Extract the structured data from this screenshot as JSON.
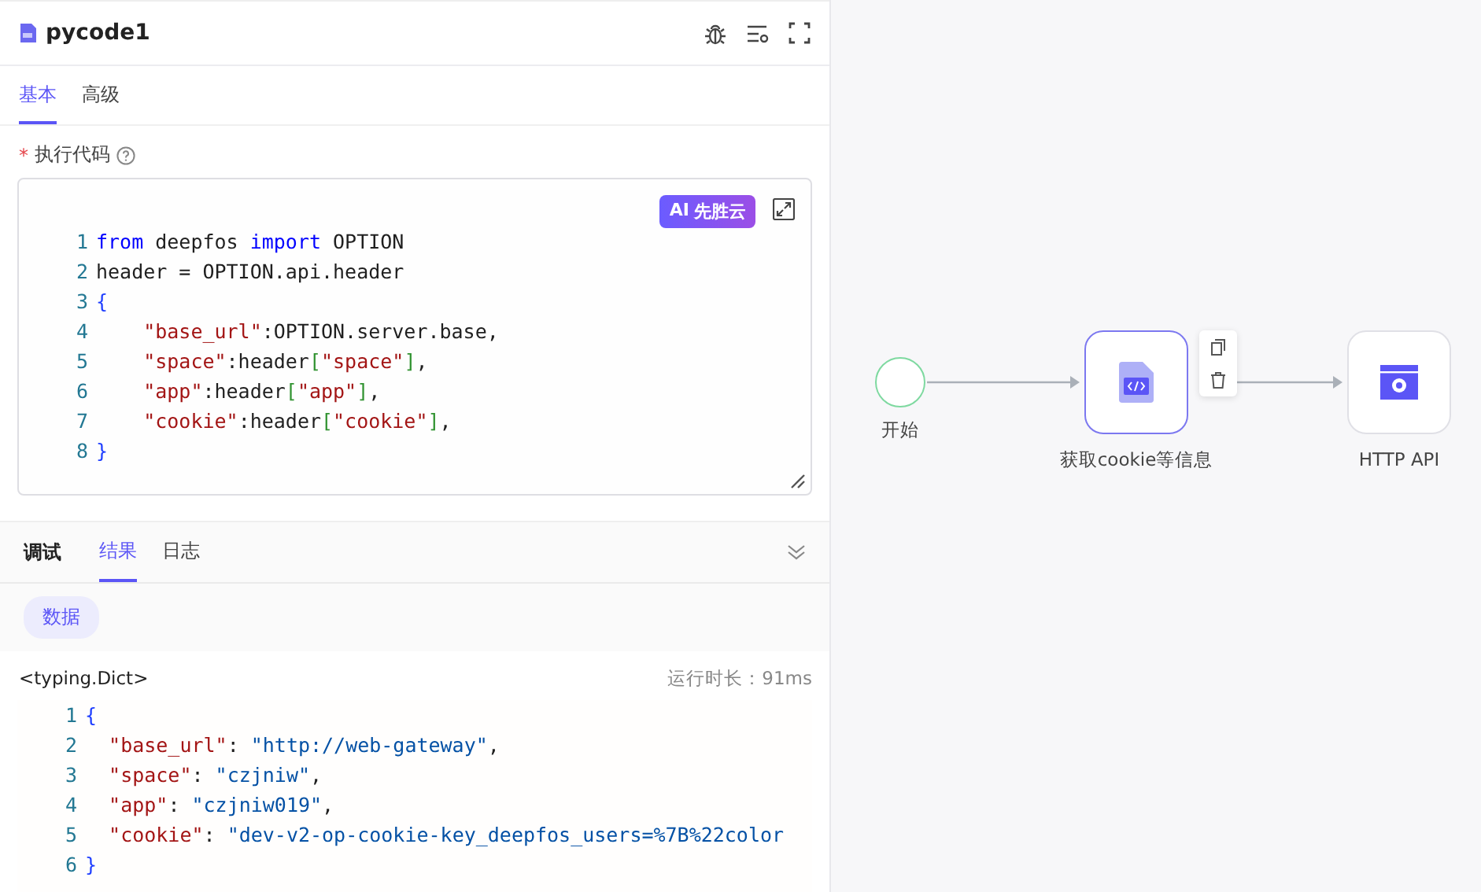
{
  "panel": {
    "title": "pycode1",
    "tabs": [
      {
        "label": "基本",
        "selected": true
      },
      {
        "label": "高级",
        "selected": false
      }
    ],
    "field": {
      "required_mark": "*",
      "label": "执行代码"
    },
    "ai_button": {
      "label": "AI",
      "brand": "先胜云"
    },
    "code_lines": [
      {
        "number": "1",
        "tokens": [
          {
            "kind": "kw",
            "text": "from"
          },
          {
            "kind": "plain",
            "text": " deepfos "
          },
          {
            "kind": "kw",
            "text": "import"
          },
          {
            "kind": "plain",
            "text": " OPTION"
          }
        ]
      },
      {
        "number": "2",
        "tokens": [
          {
            "kind": "plain",
            "text": "header = OPTION.api.header"
          }
        ]
      },
      {
        "number": "3",
        "tokens": [
          {
            "kind": "brace",
            "text": "{"
          }
        ]
      },
      {
        "number": "4",
        "indented": true,
        "tokens": [
          {
            "kind": "str",
            "text": "\"base_url\""
          },
          {
            "kind": "plain",
            "text": ":OPTION.server.base,"
          }
        ]
      },
      {
        "number": "5",
        "indented": true,
        "tokens": [
          {
            "kind": "str",
            "text": "\"space\""
          },
          {
            "kind": "plain",
            "text": ":header"
          },
          {
            "kind": "bracket",
            "text": "["
          },
          {
            "kind": "str",
            "text": "\"space\""
          },
          {
            "kind": "bracket",
            "text": "]"
          },
          {
            "kind": "plain",
            "text": ","
          }
        ]
      },
      {
        "number": "6",
        "indented": true,
        "tokens": [
          {
            "kind": "str",
            "text": "\"app\""
          },
          {
            "kind": "plain",
            "text": ":header"
          },
          {
            "kind": "bracket",
            "text": "["
          },
          {
            "kind": "str",
            "text": "\"app\""
          },
          {
            "kind": "bracket",
            "text": "]"
          },
          {
            "kind": "plain",
            "text": ","
          }
        ]
      },
      {
        "number": "7",
        "indented": true,
        "tokens": [
          {
            "kind": "str",
            "text": "\"cookie\""
          },
          {
            "kind": "plain",
            "text": ":header"
          },
          {
            "kind": "bracket",
            "text": "["
          },
          {
            "kind": "str",
            "text": "\"cookie\""
          },
          {
            "kind": "bracket",
            "text": "]"
          },
          {
            "kind": "plain",
            "text": ","
          }
        ]
      },
      {
        "number": "8",
        "tokens": [
          {
            "kind": "brace",
            "text": "}"
          }
        ]
      }
    ]
  },
  "debug": {
    "title": "调试",
    "tabs": [
      {
        "label": "结果",
        "selected": true
      },
      {
        "label": "日志",
        "selected": false
      }
    ],
    "chip": "数据",
    "type": "<typing.Dict>",
    "runtime": "运行时长：91ms",
    "result_lines": [
      {
        "number": "1",
        "tokens": [
          {
            "kind": "brace",
            "text": "{"
          }
        ]
      },
      {
        "number": "2",
        "indented": true,
        "tokens": [
          {
            "kind": "key",
            "text": "\"base_url\""
          },
          {
            "kind": "plain",
            "text": ": "
          },
          {
            "kind": "value",
            "text": "\"http://web-gateway\""
          },
          {
            "kind": "plain",
            "text": ","
          }
        ]
      },
      {
        "number": "3",
        "indented": true,
        "tokens": [
          {
            "kind": "key",
            "text": "\"space\""
          },
          {
            "kind": "plain",
            "text": ": "
          },
          {
            "kind": "value",
            "text": "\"czjniw\""
          },
          {
            "kind": "plain",
            "text": ","
          }
        ]
      },
      {
        "number": "4",
        "indented": true,
        "tokens": [
          {
            "kind": "key",
            "text": "\"app\""
          },
          {
            "kind": "plain",
            "text": ": "
          },
          {
            "kind": "value",
            "text": "\"czjniw019\""
          },
          {
            "kind": "plain",
            "text": ","
          }
        ]
      },
      {
        "number": "5",
        "indented": true,
        "tokens": [
          {
            "kind": "key",
            "text": "\"cookie\""
          },
          {
            "kind": "plain",
            "text": ": "
          },
          {
            "kind": "value",
            "text": "\"dev-v2-op-cookie-key_deepfos_users=%7B%22color"
          }
        ]
      },
      {
        "number": "6",
        "tokens": [
          {
            "kind": "brace",
            "text": "}"
          }
        ]
      }
    ]
  },
  "flow": {
    "nodes": [
      {
        "kind": "start",
        "label": "开始",
        "selected": false
      },
      {
        "kind": "code",
        "label": "获取cookie等信息",
        "selected": true
      },
      {
        "kind": "http",
        "label": "HTTP API",
        "selected": false
      }
    ]
  }
}
